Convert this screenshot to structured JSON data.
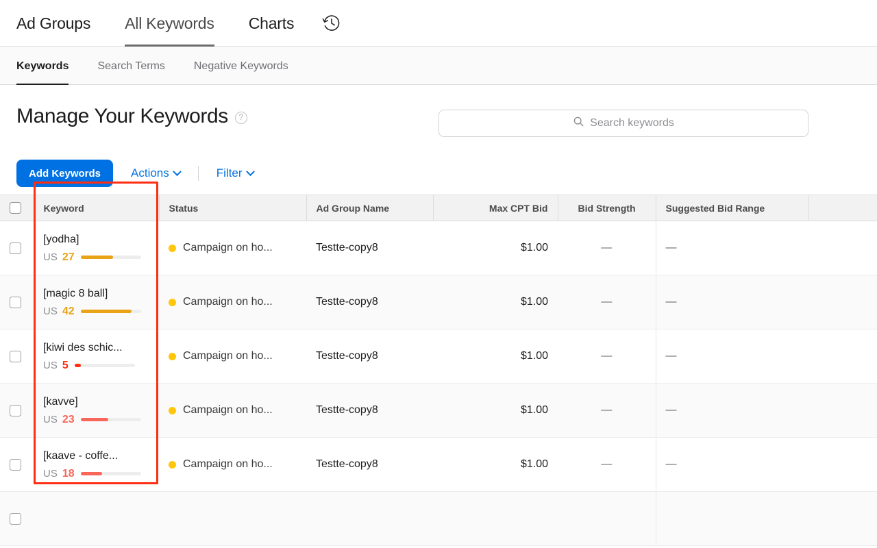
{
  "top_nav": {
    "items": [
      {
        "label": "Ad Groups",
        "active": false
      },
      {
        "label": "All Keywords",
        "active": true
      },
      {
        "label": "Charts",
        "active": false
      }
    ],
    "history_icon": "history-clock-icon"
  },
  "sub_nav": {
    "items": [
      {
        "label": "Keywords",
        "active": true
      },
      {
        "label": "Search Terms",
        "active": false
      },
      {
        "label": "Negative Keywords",
        "active": false
      }
    ]
  },
  "header": {
    "title": "Manage Your Keywords",
    "help_icon": "?",
    "help_icon_name": "help-question-icon"
  },
  "search": {
    "placeholder": "Search keywords",
    "value": "",
    "icon": "search-icon"
  },
  "toolbar": {
    "add_keywords_label": "Add Keywords",
    "actions_label": "Actions",
    "filter_label": "Filter",
    "primary_color": "#0071e3"
  },
  "table": {
    "columns": [
      "Keyword",
      "Status",
      "Ad Group Name",
      "Max CPT Bid",
      "Bid Strength",
      "Suggested Bid Range"
    ],
    "rows": [
      {
        "keyword": "[yodha]",
        "geo": "US",
        "score": "27",
        "score_pct": 27,
        "score_color": "#e8a317",
        "status": "Campaign on ho...",
        "status_color": "#ffc60a",
        "ad_group": "Testte-copy8",
        "max_cpt_bid": "$1.00",
        "bid_strength": "—",
        "suggested_bid_range": "—"
      },
      {
        "keyword": "[magic 8 ball]",
        "geo": "US",
        "score": "42",
        "score_pct": 42,
        "score_color": "#e8a317",
        "status": "Campaign on ho...",
        "status_color": "#ffc60a",
        "ad_group": "Testte-copy8",
        "max_cpt_bid": "$1.00",
        "bid_strength": "—",
        "suggested_bid_range": "—"
      },
      {
        "keyword": "[kiwi des schic...",
        "geo": "US",
        "score": "5",
        "score_pct": 5,
        "score_color": "#ff2d11",
        "status": "Campaign on ho...",
        "status_color": "#ffc60a",
        "ad_group": "Testte-copy8",
        "max_cpt_bid": "$1.00",
        "bid_strength": "—",
        "suggested_bid_range": "—"
      },
      {
        "keyword": "[kavve]",
        "geo": "US",
        "score": "23",
        "score_pct": 23,
        "score_color": "#f8675a",
        "status": "Campaign on ho...",
        "status_color": "#ffc60a",
        "ad_group": "Testte-copy8",
        "max_cpt_bid": "$1.00",
        "bid_strength": "—",
        "suggested_bid_range": "—"
      },
      {
        "keyword": "[kaave - coffe...",
        "geo": "US",
        "score": "18",
        "score_pct": 18,
        "score_color": "#f8675a",
        "status": "Campaign on ho...",
        "status_color": "#ffc60a",
        "ad_group": "Testte-copy8",
        "max_cpt_bid": "$1.00",
        "bid_strength": "—",
        "suggested_bid_range": "—"
      }
    ]
  },
  "annotation": {
    "highlight_color": "#ff2d11",
    "target": "keyword-column"
  }
}
